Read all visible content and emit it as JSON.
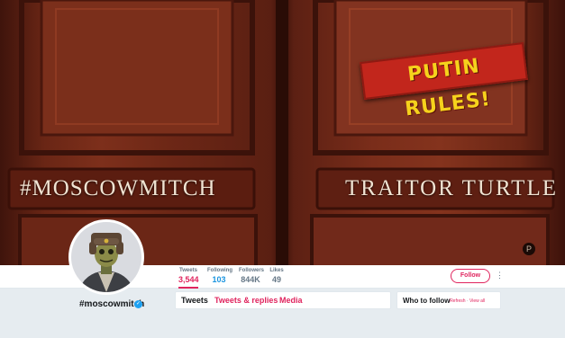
{
  "banner": {
    "plaque_left": "#MOSCOWMITCH",
    "plaque_right": "TRAITOR TURTLE",
    "sticker": "PUTIN RULES!",
    "corner_logo": "P"
  },
  "profile": {
    "handle": "#moscowmitch",
    "verified_glyph": "✓"
  },
  "stats": [
    {
      "label": "Tweets",
      "value": "3,544"
    },
    {
      "label": "Following",
      "value": "103"
    },
    {
      "label": "Followers",
      "value": "844K"
    },
    {
      "label": "Likes",
      "value": "49"
    }
  ],
  "actions": {
    "follow_label": "Follow",
    "more_glyph": "⋮"
  },
  "tabs": [
    {
      "label": "Tweets"
    },
    {
      "label": "Tweets & replies"
    },
    {
      "label": "Media"
    }
  ],
  "who_to_follow": {
    "title": "Who to follow",
    "separator": "·",
    "refresh": "Refresh",
    "view_all": "View all"
  },
  "colors": {
    "accent": "#e0245e",
    "link_blue": "#1b95e0",
    "verified": "#1da1f2"
  }
}
